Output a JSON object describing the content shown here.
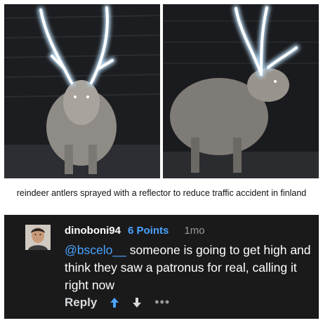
{
  "caption": "reindeer antlers sprayed with a reflector to reduce traffic accident in finland",
  "comment": {
    "username": "dinoboni94",
    "points": "6 Points",
    "time": "1mo",
    "mention": "@bscelo__",
    "text": " someone is going to get high and think they saw a patronus for real, calling it right now",
    "reply_label": "Reply",
    "more_label": "•••"
  },
  "icons": {
    "upvote": "upvote-arrow-icon",
    "downvote": "downvote-arrow-icon",
    "more": "more-dots-icon"
  },
  "colors": {
    "comment_bg": "#1a1a1b",
    "accent": "#4aa3ff",
    "upvote": "#4aa3ff",
    "downvote": "#d7dadc"
  }
}
